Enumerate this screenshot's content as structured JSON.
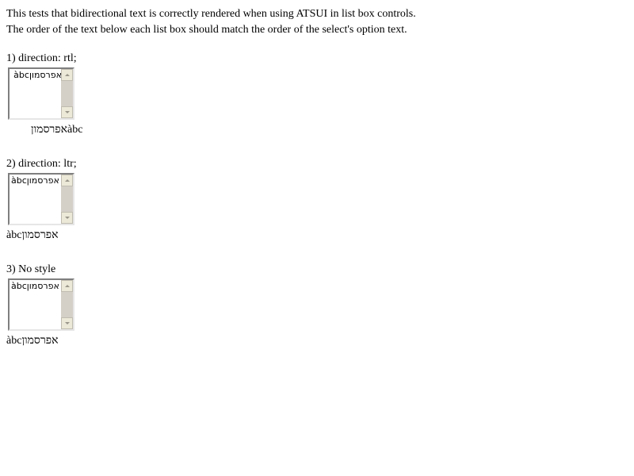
{
  "intro": {
    "line1": "This tests that bidirectional text is correctly rendered when using ATSUI in list box controls.",
    "line2": "The order of the text below each list box should match the order of the select's option text."
  },
  "sections": [
    {
      "title": "1) direction: rtl;",
      "option_text": "אפרסמוןàbc",
      "result_text": "אפרסמוןàbc"
    },
    {
      "title": "2) direction: ltr;",
      "option_text": "àbcאפרסמון",
      "result_text": "àbcאפרסמון"
    },
    {
      "title": "3) No style",
      "option_text": "àbcאפרסמון",
      "result_text": "àbcאפרסמון"
    }
  ],
  "icons": {
    "scroll_up": "triangle-up",
    "scroll_down": "triangle-down"
  },
  "colors": {
    "background": "#ffffff",
    "text": "#000000",
    "scrollbar_track": "#d4d0c8",
    "scrollbar_button": "#ece9d8",
    "arrow": "#9a968a"
  }
}
